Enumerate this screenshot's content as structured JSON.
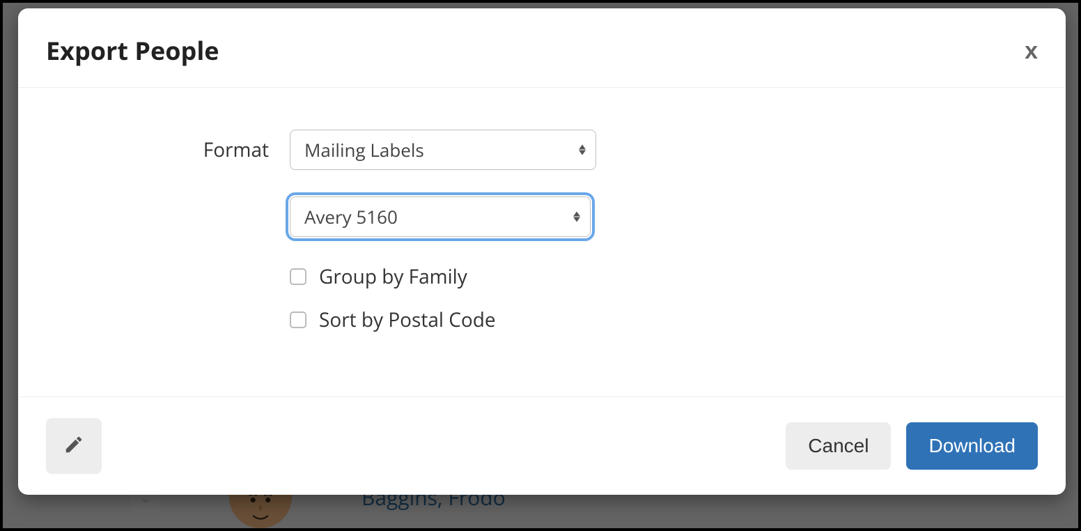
{
  "background": {
    "row_name": "Baggins, Frodo"
  },
  "modal": {
    "title": "Export People",
    "close_label": "x",
    "format_label": "Format",
    "format_select": {
      "value": "Mailing Labels"
    },
    "template_select": {
      "value": "Avery 5160"
    },
    "checkboxes": {
      "group_by_family": {
        "label": "Group by Family",
        "checked": false
      },
      "sort_by_postal": {
        "label": "Sort by Postal Code",
        "checked": false
      }
    },
    "footer": {
      "edit_icon": "pencil",
      "cancel_label": "Cancel",
      "download_label": "Download"
    }
  }
}
